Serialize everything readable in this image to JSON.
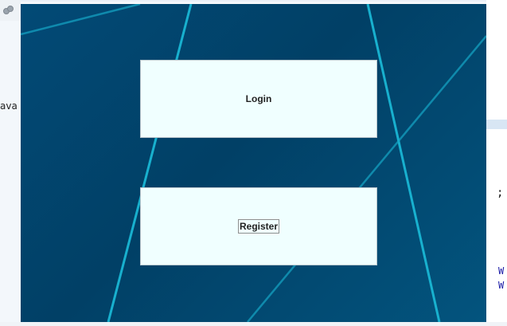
{
  "background_ide": {
    "left_text": "ava",
    "right_semicolon": ";",
    "right_w_1": "W",
    "right_w_2": "W"
  },
  "menu": {
    "login_label": "Login",
    "register_label": "Register",
    "focused": "register"
  },
  "colors": {
    "window_background": "#014066",
    "accent_lines": "#19b6d4",
    "button_background": "#f0ffff"
  }
}
